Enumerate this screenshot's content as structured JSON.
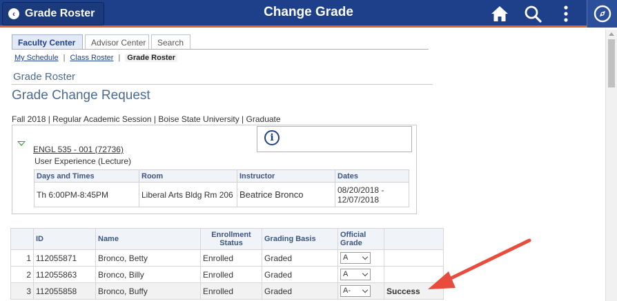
{
  "header": {
    "back_label": "Grade Roster",
    "title": "Change Grade",
    "icons": [
      "home-icon",
      "search-icon",
      "more-vert-icon",
      "compass-icon"
    ],
    "color": "#1e3f8a",
    "accent": "#e8632b"
  },
  "tabs": [
    {
      "label": "Faculty Center",
      "active": true
    },
    {
      "label": "Advisor Center",
      "active": false
    },
    {
      "label": "Search",
      "active": false
    }
  ],
  "breadcrumb": {
    "items": [
      "My Schedule",
      "Class Roster"
    ],
    "separator": "|",
    "current": "Grade Roster"
  },
  "page": {
    "subtitle": "Grade Roster",
    "title": "Grade Change Request",
    "term": "Fall 2018 | Regular Academic Session | Boise State University | Graduate"
  },
  "course": {
    "link": "ENGL 535 - 001 (72736)",
    "desc": "User Experience (Lecture)"
  },
  "meeting_table": {
    "headers": [
      "Days and Times",
      "Room",
      "Instructor",
      "Dates"
    ],
    "row": {
      "days": "Th 6:00PM-8:45PM",
      "room": "Liberal Arts Bldg Rm 206",
      "instructor": "Beatrice Bronco",
      "dates": "08/20/2018 - 12/07/2018"
    }
  },
  "roster": {
    "headers": {
      "id": "ID",
      "name": "Name",
      "status": "Enrollment Status",
      "basis": "Grading Basis",
      "grade": "Official Grade"
    },
    "rows": [
      {
        "num": "1",
        "id": "112055871",
        "name": "Bronco, Betty",
        "status": "Enrolled",
        "basis": "Graded",
        "grade": "A",
        "note": ""
      },
      {
        "num": "2",
        "id": "112055863",
        "name": "Bronco, Billy",
        "status": "Enrolled",
        "basis": "Graded",
        "grade": "A",
        "note": ""
      },
      {
        "num": "3",
        "id": "112055858",
        "name": "Bronco, Buffy",
        "status": "Enrolled",
        "basis": "Graded",
        "grade": "A-",
        "note": "Success"
      }
    ]
  },
  "annotation": {
    "arrow_color": "#e84c3d"
  }
}
